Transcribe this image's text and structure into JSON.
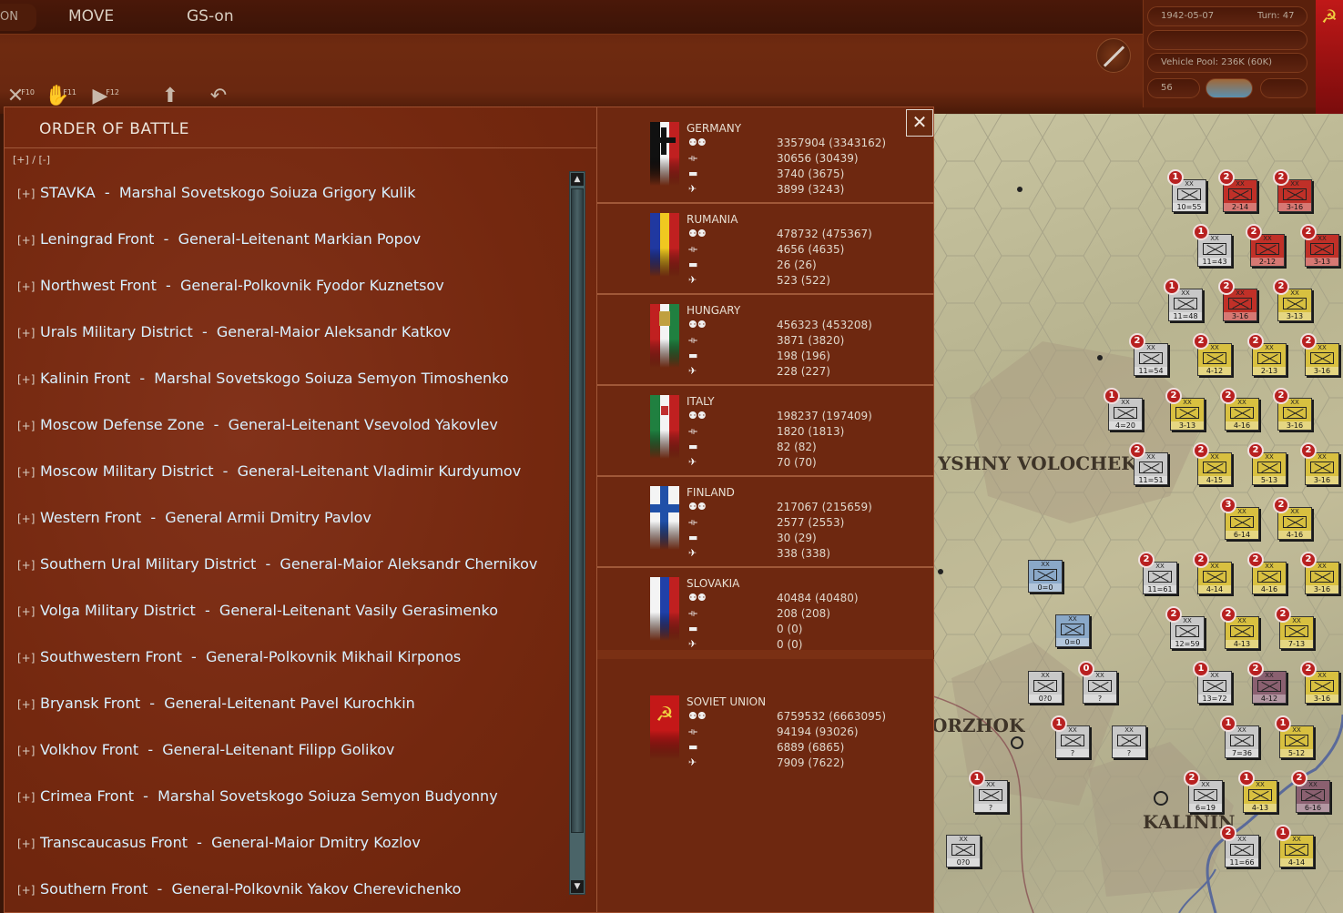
{
  "topbar": {
    "tab_on": "ON",
    "tab_move": "MOVE",
    "tab_gs": "GS-on",
    "hotkeys": [
      "F10",
      "F11",
      "F12"
    ]
  },
  "info": {
    "date": "1942-05-07",
    "turn": "Turn: 47",
    "vehicle_pool": "Vehicle Pool: 236K (60K)",
    "count": "56"
  },
  "oob": {
    "title": "ORDER OF BATTLE",
    "expand_all": "[+] / [-]",
    "plus": "[+]",
    "close": "✕",
    "rows": [
      "STAVKA  -  Marshal Sovetskogo Soiuza Grigory Kulik",
      "Leningrad Front  -  General-Leitenant Markian Popov",
      "Northwest Front  -  General-Polkovnik Fyodor Kuznetsov",
      "Urals Military District  -  General-Maior Aleksandr Katkov",
      "Kalinin Front  -  Marshal Sovetskogo Soiuza Semyon Timoshenko",
      "Moscow Defense Zone  -  General-Leitenant Vsevolod Yakovlev",
      "Moscow Military District  -  General-Leitenant Vladimir Kurdyumov",
      "Western Front  -  General Armii Dmitry Pavlov",
      "Southern Ural Military District  -  General-Maior Aleksandr Chernikov",
      "Volga Military District  -  General-Leitenant Vasily Gerasimenko",
      "Southwestern Front  -  General-Polkovnik Mikhail Kirponos",
      "Bryansk Front  -  General-Leitenant Pavel Kurochkin",
      "Volkhov Front  -  General-Leitenant Filipp Golikov",
      "Crimea Front  -  Marshal Sovetskogo Soiuza Semyon Budyonny",
      "Transcaucasus Front  -  General-Maior Dmitry Kozlov",
      "Southern Front  -  General-Polkovnik Yakov Cherevichenko"
    ]
  },
  "nations": [
    {
      "name": "GERMANY",
      "stats": [
        "3357904 (3343162)",
        "30656 (30439)",
        "3740 (3675)",
        "3899 (3243)"
      ]
    },
    {
      "name": "RUMANIA",
      "stats": [
        "478732 (475367)",
        "4656 (4635)",
        "26 (26)",
        "523 (522)"
      ]
    },
    {
      "name": "HUNGARY",
      "stats": [
        "456323 (453208)",
        "3871 (3820)",
        "198 (196)",
        "228 (227)"
      ]
    },
    {
      "name": "ITALY",
      "stats": [
        "198237 (197409)",
        "1820 (1813)",
        "82 (82)",
        "70 (70)"
      ]
    },
    {
      "name": "FINLAND",
      "stats": [
        "217067 (215659)",
        "2577 (2553)",
        "30 (29)",
        "338 (338)"
      ]
    },
    {
      "name": "SLOVAKIA",
      "stats": [
        "40484 (40480)",
        "208 (208)",
        "0 (0)",
        "0 (0)"
      ]
    },
    {
      "name": "SOVIET UNION",
      "stats": [
        "6759532 (6663095)",
        "94194 (93026)",
        "6889 (6865)",
        "7909 (7622)"
      ]
    }
  ],
  "stat_icons": [
    "infantry-icon",
    "artillery-icon",
    "tank-icon",
    "aircraft-icon"
  ],
  "map": {
    "labels": [
      "YSHNY VOLOCHEK",
      "ORZHOK",
      "KALININ"
    ],
    "units": [
      {
        "c": "g",
        "s": "10=55",
        "b": "1"
      },
      {
        "c": "r",
        "s": "2-14",
        "b": "2"
      },
      {
        "c": "r",
        "s": "3-16",
        "b": "2"
      },
      {
        "c": "g",
        "s": "11=43",
        "b": "1"
      },
      {
        "c": "r",
        "s": "2-12",
        "b": "2"
      },
      {
        "c": "r",
        "s": "3-13",
        "b": "2"
      },
      {
        "c": "g",
        "s": "11=48",
        "b": "1"
      },
      {
        "c": "r",
        "s": "3-16",
        "b": "2"
      },
      {
        "c": "y",
        "s": "3-13",
        "b": "2"
      },
      {
        "c": "g",
        "s": "11=54",
        "b": "2"
      },
      {
        "c": "y",
        "s": "4-12",
        "b": "2"
      },
      {
        "c": "y",
        "s": "2-13",
        "b": "2"
      },
      {
        "c": "y",
        "s": "3-16",
        "b": "2"
      },
      {
        "c": "g",
        "s": "4=20",
        "b": "1"
      },
      {
        "c": "y",
        "s": "3-13",
        "b": "2"
      },
      {
        "c": "y",
        "s": "4-16",
        "b": "2"
      },
      {
        "c": "y",
        "s": "3-16",
        "b": "2"
      },
      {
        "c": "g",
        "s": "11=51",
        "b": "2"
      },
      {
        "c": "y",
        "s": "4-15",
        "b": "2"
      },
      {
        "c": "y",
        "s": "5-13",
        "b": "2"
      },
      {
        "c": "y",
        "s": "3-16",
        "b": "2"
      },
      {
        "c": "y",
        "s": "6-14",
        "b": "3"
      },
      {
        "c": "y",
        "s": "4-16",
        "b": "2"
      },
      {
        "c": "b",
        "s": "0=0",
        "b": ""
      },
      {
        "c": "g",
        "s": "11=61",
        "b": "2"
      },
      {
        "c": "y",
        "s": "4-14",
        "b": "2"
      },
      {
        "c": "y",
        "s": "4-16",
        "b": "2"
      },
      {
        "c": "y",
        "s": "3-16",
        "b": "2"
      },
      {
        "c": "b",
        "s": "0=0",
        "b": ""
      },
      {
        "c": "g",
        "s": "12=59",
        "b": "2"
      },
      {
        "c": "y",
        "s": "4-13",
        "b": "2"
      },
      {
        "c": "y",
        "s": "7-13",
        "b": "2"
      },
      {
        "c": "g",
        "s": "0?0",
        "b": ""
      },
      {
        "c": "g",
        "s": "?",
        "b": "0"
      },
      {
        "c": "g",
        "s": "13=72",
        "b": "1"
      },
      {
        "c": "p",
        "s": "4-12",
        "b": "2"
      },
      {
        "c": "y",
        "s": "3-16",
        "b": "2"
      },
      {
        "c": "g",
        "s": "?",
        "b": "1"
      },
      {
        "c": "g",
        "s": "?",
        "b": ""
      },
      {
        "c": "g",
        "s": "7=36",
        "b": "1"
      },
      {
        "c": "y",
        "s": "5-12",
        "b": "1"
      },
      {
        "c": "g",
        "s": "?",
        "b": "1"
      },
      {
        "c": "g",
        "s": "6=19",
        "b": "2"
      },
      {
        "c": "y",
        "s": "4-13",
        "b": "1"
      },
      {
        "c": "p",
        "s": "6-16",
        "b": "2"
      },
      {
        "c": "g",
        "s": "0?0",
        "b": ""
      },
      {
        "c": "g",
        "s": "11=66",
        "b": "2"
      },
      {
        "c": "y",
        "s": "4-14",
        "b": "1"
      }
    ]
  }
}
